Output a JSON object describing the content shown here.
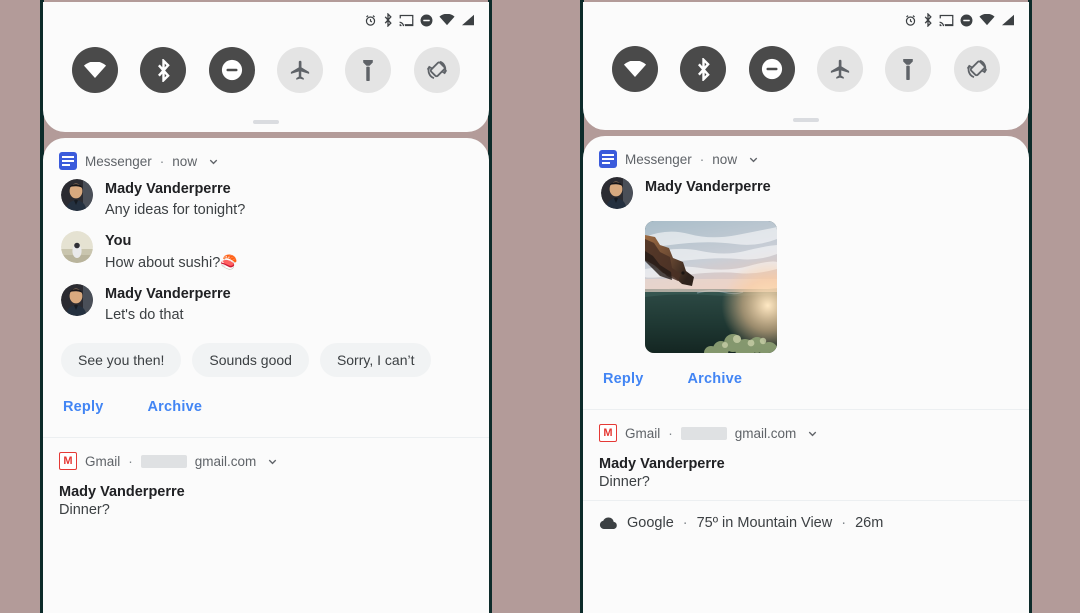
{
  "background_color": "#b39b99",
  "frame_color": "#0d2b2a",
  "accent_color": "#4285f4",
  "statusbar": {
    "icons": [
      "alarm-icon",
      "bluetooth-icon",
      "cast-icon",
      "do-not-disturb-icon",
      "wifi-icon",
      "signal-icon"
    ]
  },
  "quick_settings": {
    "tiles": [
      {
        "name": "wifi-tile",
        "icon": "wifi-icon",
        "state": "on"
      },
      {
        "name": "bluetooth-tile",
        "icon": "bluetooth-icon",
        "state": "on"
      },
      {
        "name": "dnd-tile",
        "icon": "do-not-disturb-icon",
        "state": "on"
      },
      {
        "name": "airplane-tile",
        "icon": "airplane-icon",
        "state": "off"
      },
      {
        "name": "flashlight-tile",
        "icon": "flashlight-icon",
        "state": "off"
      },
      {
        "name": "auto-rotate-tile",
        "icon": "auto-rotate-icon",
        "state": "off"
      }
    ],
    "handle": "drag-handle"
  },
  "left_panel": {
    "messenger": {
      "app_name": "Messenger",
      "separator": "·",
      "time": "now",
      "chevron": "chevron-down-icon",
      "messages": [
        {
          "sender": "Mady Vanderperre",
          "text": "Any ideas for tonight?",
          "avatar": "avatar-mady"
        },
        {
          "sender": "You",
          "text": "How about sushi?",
          "emoji": "🍣",
          "avatar": "avatar-you"
        },
        {
          "sender": "Mady Vanderperre",
          "text": "Let's do that",
          "avatar": "avatar-mady"
        }
      ],
      "smart_replies": [
        "See you then!",
        "Sounds good",
        "Sorry, I can’t"
      ],
      "actions": [
        "Reply",
        "Archive"
      ]
    },
    "gmail": {
      "app_name": "Gmail",
      "separator": "·",
      "account_redacted": true,
      "account_suffix": "gmail.com",
      "chevron": "chevron-down-icon",
      "title": "Mady Vanderperre",
      "subject": "Dinner?"
    }
  },
  "right_panel": {
    "messenger": {
      "app_name": "Messenger",
      "separator": "·",
      "time": "now",
      "chevron": "chevron-down-icon",
      "sender": "Mady Vanderperre",
      "attachment": "photo-attachment",
      "actions": [
        "Reply",
        "Archive"
      ]
    },
    "gmail": {
      "app_name": "Gmail",
      "separator": "·",
      "account_redacted": true,
      "account_suffix": "gmail.com",
      "chevron": "chevron-down-icon",
      "title": "Mady Vanderperre",
      "subject": "Dinner?"
    },
    "weather": {
      "icon": "cloud-icon",
      "app_name": "Google",
      "sep1": "·",
      "temperature": "75º in Mountain View",
      "sep2": "·",
      "time": "26m"
    }
  }
}
